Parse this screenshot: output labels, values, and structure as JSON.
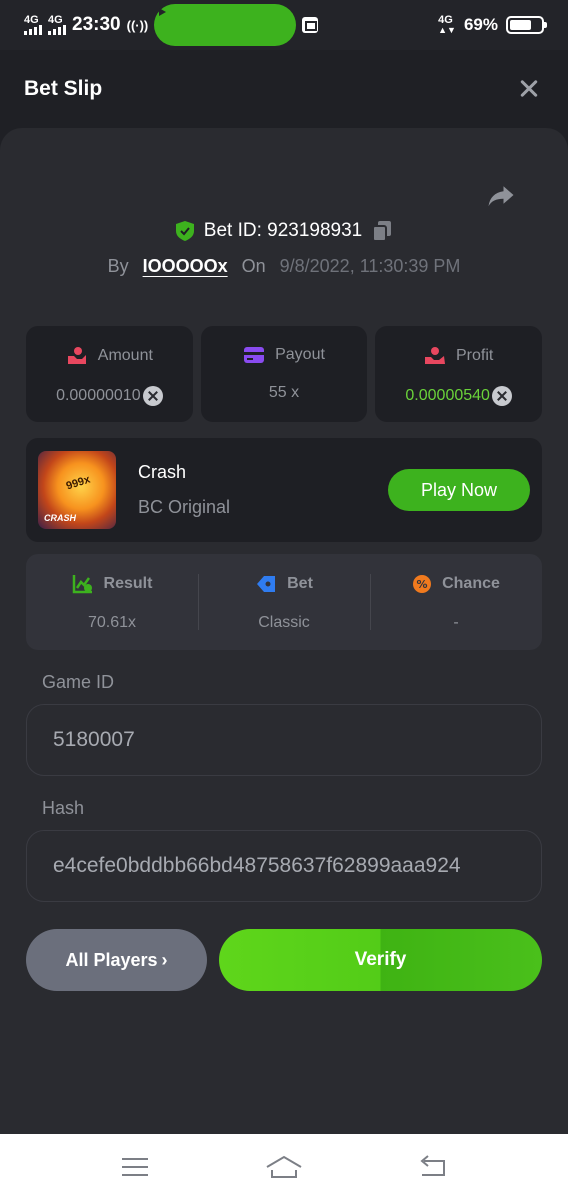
{
  "status_bar": {
    "network_1": "4G",
    "network_2": "4G",
    "time": "23:30",
    "network_right": "4G",
    "battery": "69%"
  },
  "header": {
    "title": "Bet Slip"
  },
  "bet": {
    "id_label": "Bet ID: 923198931",
    "by_label": "By",
    "username": "IOOOOOx",
    "on_label": "On",
    "date": "9/8/2022, 11:30:39 PM"
  },
  "stats": {
    "amount_label": "Amount",
    "amount_value": "0.00000010",
    "payout_label": "Payout",
    "payout_value": "55 x",
    "profit_label": "Profit",
    "profit_value": "0.00000540"
  },
  "game": {
    "name": "Crash",
    "provider": "BC Original",
    "thumb_multiplier": "999x",
    "thumb_brand": "CRASH",
    "play_label": "Play Now"
  },
  "results": {
    "result_label": "Result",
    "result_value": "70.61x",
    "bet_label": "Bet",
    "bet_value": "Classic",
    "chance_label": "Chance",
    "chance_value": "-"
  },
  "fields": {
    "game_id_label": "Game ID",
    "game_id_value": "5180007",
    "hash_label": "Hash",
    "hash_value": "e4cefe0bddbb66bd48758637f62899aaa924"
  },
  "actions": {
    "all_players_label": "All Players",
    "verify_label": "Verify"
  },
  "colors": {
    "accent_green": "#3db21e",
    "profit_green": "#6ad33a",
    "background": "#1f2025",
    "card": "#2a2b30"
  }
}
